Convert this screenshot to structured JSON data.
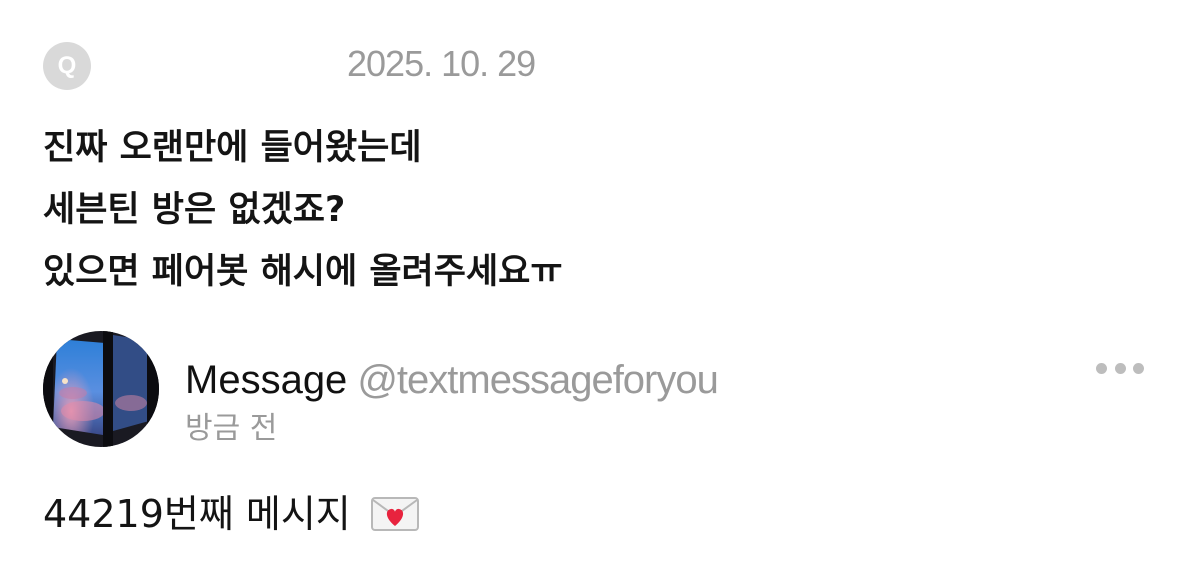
{
  "question": {
    "badge_letter": "Q",
    "date": "2025. 10. 29",
    "lines": [
      "진짜 오랜만에 들어왔는데",
      "세븐틴 방은 없겠죠?",
      "있으면 페어봇 해시에 올려주세요ㅠ"
    ]
  },
  "answer": {
    "author_name": "Message",
    "author_handle": "@textmessageforyou",
    "time": "방금 전",
    "avatar_icon": "window-sky-avatar",
    "more_icon": "more-dots-icon",
    "text": "44219번째 메시지",
    "emoji_icon": "love-letter-icon"
  },
  "colors": {
    "muted": "#9a9a9a",
    "badge": "#d9d9d9",
    "text": "#141414"
  }
}
